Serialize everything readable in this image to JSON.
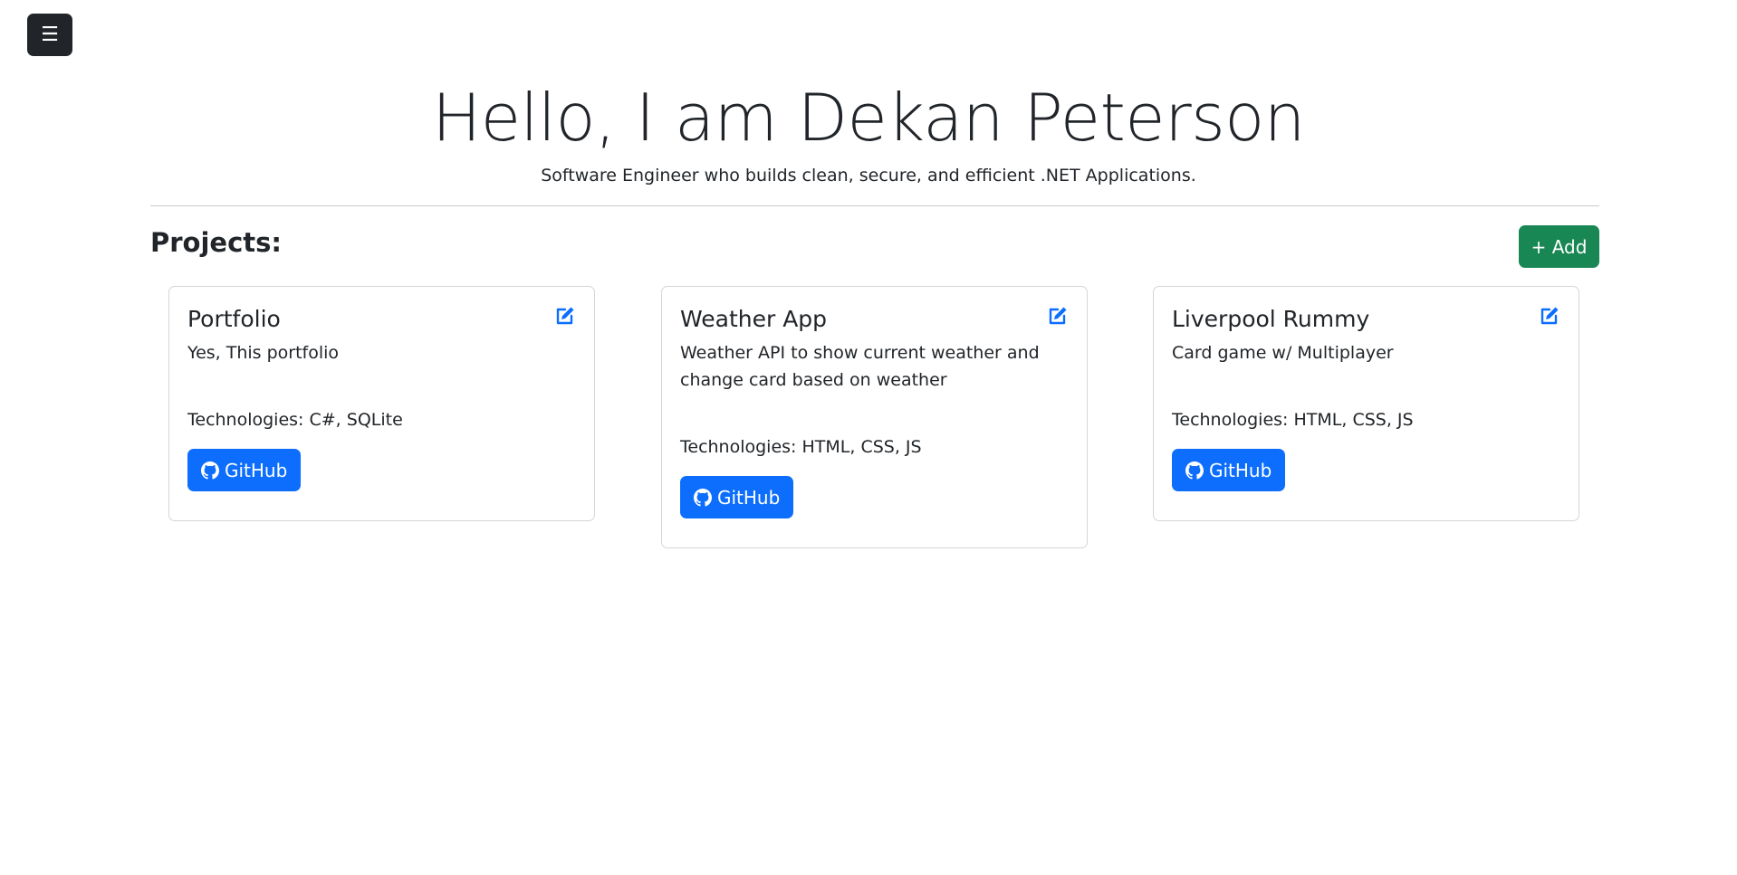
{
  "menu": {
    "icon_glyph": "☰",
    "icon": "hamburger-icon"
  },
  "hero": {
    "title": "Hello, I am Dekan Peterson",
    "subtitle": "Software Engineer who builds clean, secure, and efficient .NET Applications."
  },
  "projects": {
    "heading": "Projects:",
    "add_label": "+ Add",
    "items": [
      {
        "title": "Portfolio",
        "description": "Yes, This portfolio",
        "technologies": "Technologies: C#, SQLite",
        "github_label": "GitHub"
      },
      {
        "title": "Weather App",
        "description": "Weather API to show current weather and change card based on weather",
        "technologies": "Technologies: HTML, CSS, JS",
        "github_label": "GitHub"
      },
      {
        "title": "Liverpool Rummy",
        "description": "Card game w/ Multiplayer",
        "technologies": "Technologies: HTML, CSS, JS",
        "github_label": "GitHub"
      }
    ]
  },
  "colors": {
    "primary": "#0d6efd",
    "success": "#198754",
    "dark": "#212529"
  }
}
